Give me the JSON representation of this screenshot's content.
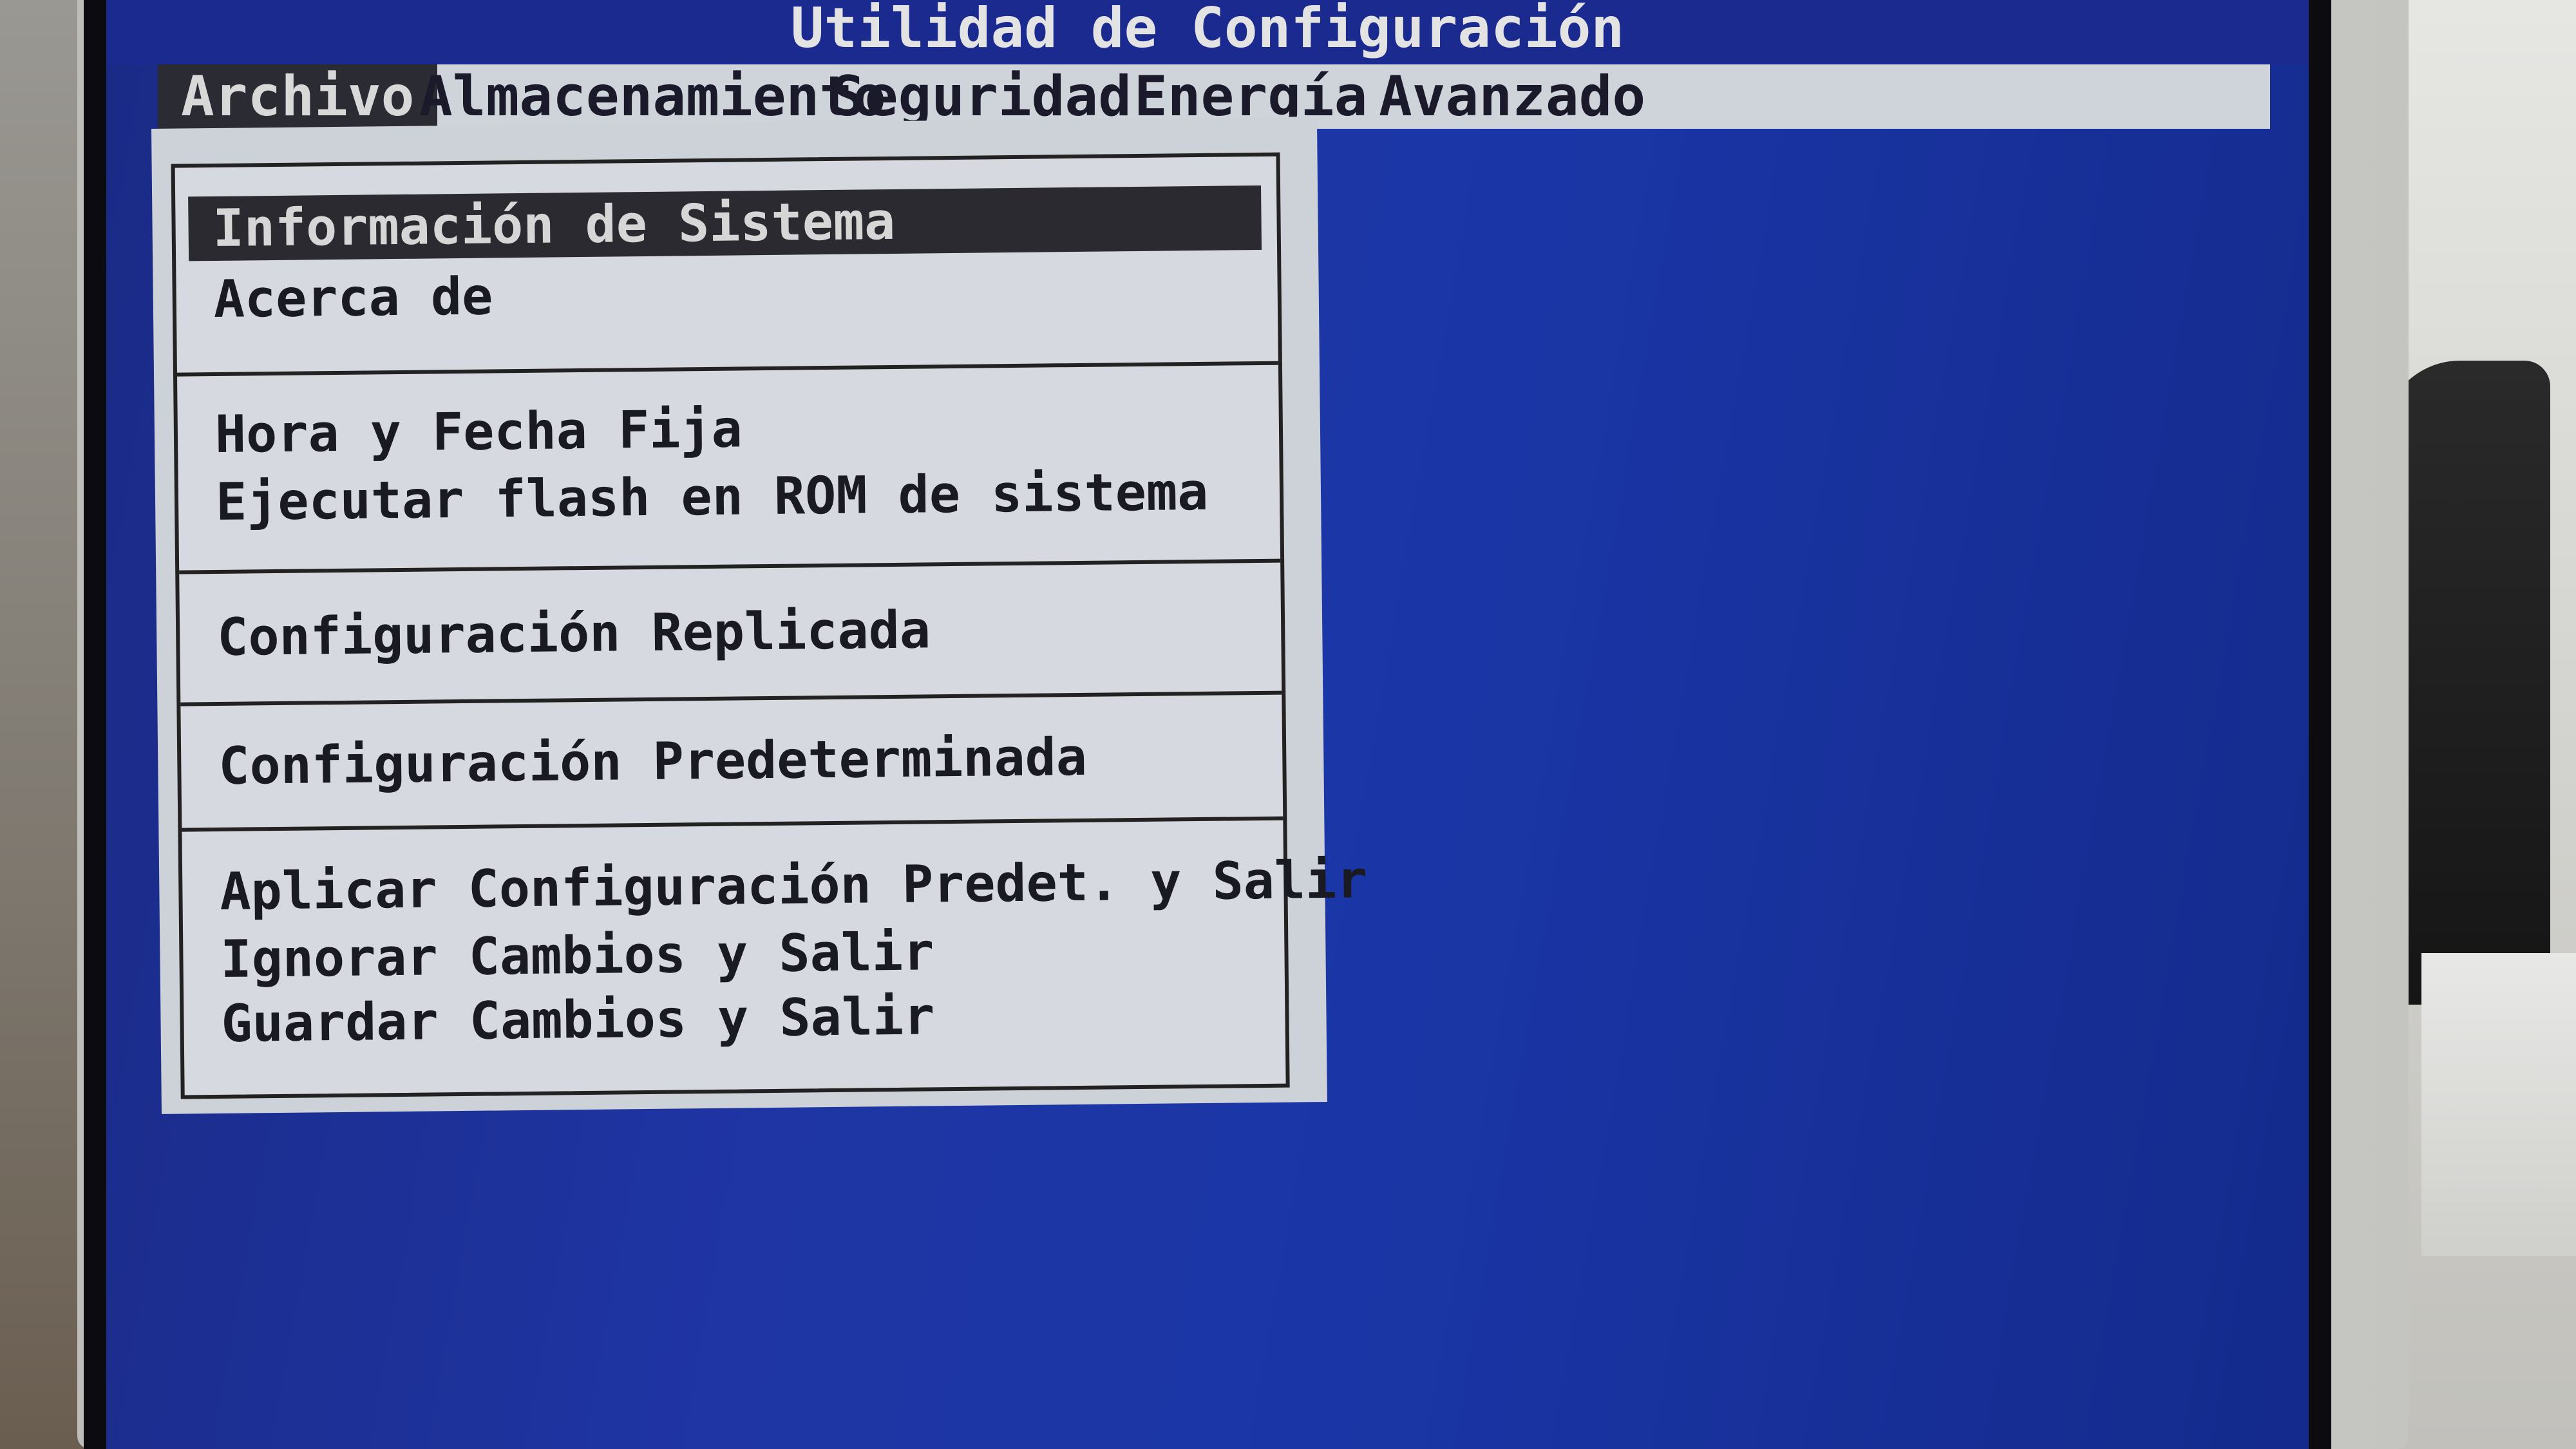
{
  "window": {
    "title": "Utilidad de Configuración"
  },
  "menu_bar": {
    "items": [
      {
        "label": "Archivo",
        "active": true
      },
      {
        "label": "Almacenamiento",
        "active": false
      },
      {
        "label": "Seguridad",
        "active": false
      },
      {
        "label": "Energía",
        "active": false
      },
      {
        "label": "Avanzado",
        "active": false
      }
    ]
  },
  "file_menu": {
    "groups": [
      [
        {
          "label": "Información de Sistema",
          "selected": true
        },
        {
          "label": "Acerca de",
          "selected": false
        }
      ],
      [
        {
          "label": "Hora y Fecha Fija",
          "selected": false
        },
        {
          "label": "Ejecutar flash en ROM de sistema",
          "selected": false
        }
      ],
      [
        {
          "label": "Configuración Replicada",
          "selected": false
        }
      ],
      [
        {
          "label": "Configuración Predeterminada",
          "selected": false
        }
      ],
      [
        {
          "label": "Aplicar Configuración Predet. y Salir",
          "selected": false
        },
        {
          "label": "Ignorar Cambios y Salir",
          "selected": false
        },
        {
          "label": "Guardar Cambios y Salir",
          "selected": false
        }
      ]
    ]
  },
  "colors": {
    "screen_background": "#1f35a4",
    "menu_bar_background": "#cfd3da",
    "highlight": "#2a2a30"
  }
}
